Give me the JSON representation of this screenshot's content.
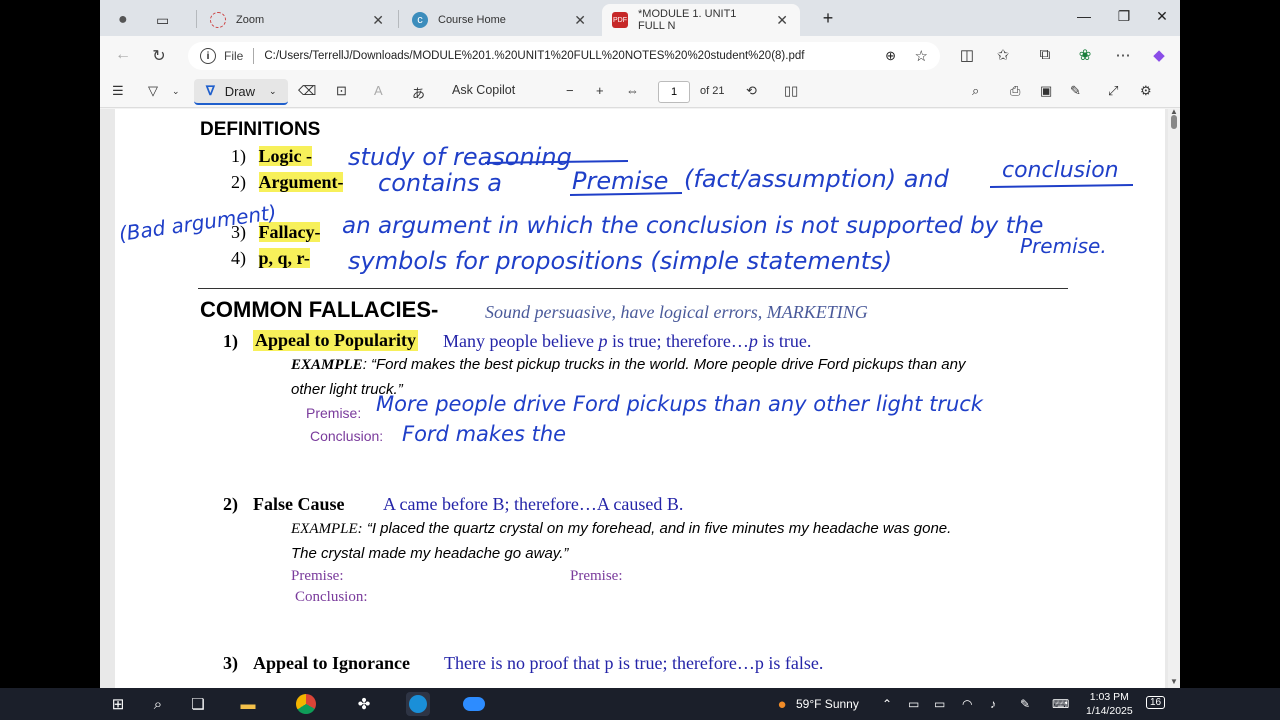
{
  "browser": {
    "tabs": [
      {
        "label": "Zoom",
        "icon": "zoom-dots-icon"
      },
      {
        "label": "Course Home",
        "icon": "course-icon"
      },
      {
        "label": "*MODULE 1. UNIT1 FULL N",
        "icon": "pdf-icon"
      }
    ],
    "address": {
      "prefix": "File",
      "url": "C:/Users/TerrellJ/Downloads/MODULE%201.%20UNIT1%20FULL%20NOTES%20%20student%20(8).pdf"
    },
    "pdf_toolbar": {
      "draw_label": "Draw",
      "ask_copilot": "Ask Copilot",
      "page_current": "1",
      "page_total": "of 21"
    }
  },
  "document": {
    "definitions_heading": "DEFINITIONS",
    "definitions": [
      {
        "num": "1)",
        "term": "Logic -"
      },
      {
        "num": "2)",
        "term": "Argument-"
      },
      {
        "num": "3)",
        "term": "Fallacy-"
      },
      {
        "num": "4)",
        "term": "p, q, r-"
      }
    ],
    "fallacies_heading": "COMMON FALLACIES-",
    "fallacies_sub": "Sound persuasive, have logical errors, MARKETING",
    "f1": {
      "num": "1)",
      "name": "Appeal to Popularity",
      "form_a": "Many people believe ",
      "form_p": "p",
      "form_b": " is true; therefore…",
      "form_p2": "p",
      "form_c": " is true.",
      "example_label": "EXAMPLE",
      "example_text": ": “Ford makes the best pickup trucks in the world. More people drive Ford pickups than any",
      "example_text2": "other light truck.”",
      "premise_label": "Premise:",
      "conclusion_label": "Conclusion:"
    },
    "f2": {
      "num": "2)",
      "name": "False Cause",
      "form": "A came before B; therefore…A caused B.",
      "example_label": "EXAMPLE:",
      "example_text": " “I placed the quartz crystal on my forehead, and in five minutes my headache was gone.",
      "example_text2": "The crystal made my headache go away.”",
      "premise_label": "Premise:",
      "premise_label2": "Premise:",
      "conclusion_label": "Conclusion:"
    },
    "f3": {
      "num": "3)",
      "name": "Appeal to Ignorance",
      "form": "There is no proof that p is true; therefore…p is false."
    }
  },
  "handwriting": {
    "logic": "study of reasoning",
    "argument_a": "contains a",
    "argument_premise": "Premise",
    "argument_b": "(fact/assumption) and",
    "argument_conclusion": "conclusion",
    "bad_argument": "(Bad argument)",
    "fallacy": "an argument in which the conclusion is not supported by the",
    "fallacy2": "Premise.",
    "symbols": "symbols for propositions (simple statements)",
    "premise_note": "More people drive Ford pickups than any other light truck",
    "conclusion_note": "Ford makes the"
  },
  "taskbar": {
    "weather": "59°F  Sunny",
    "time": "1:03 PM",
    "date": "1/14/2025",
    "notifications": "16"
  },
  "colors": {
    "ink": "#1f3fc8",
    "highlight": "#f7f05a",
    "accent": "#1f5fcc"
  }
}
